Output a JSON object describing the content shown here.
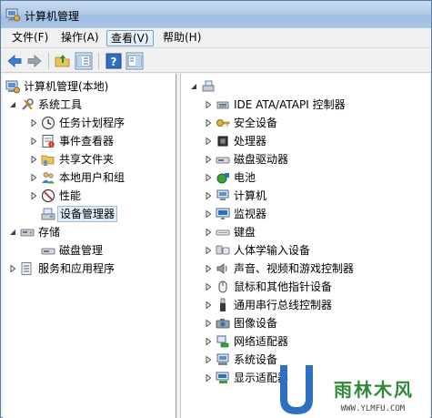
{
  "window": {
    "title": "计算机管理"
  },
  "menu": [
    {
      "label": "文件(F)"
    },
    {
      "label": "操作(A)"
    },
    {
      "label": "查看(V)"
    },
    {
      "label": "帮助(H)"
    }
  ],
  "tree": {
    "root": "计算机管理(本地)",
    "system_tools": "系统工具",
    "task_scheduler": "任务计划程序",
    "event_viewer": "事件查看器",
    "shared_folders": "共享文件夹",
    "local_users": "本地用户和组",
    "performance": "性能",
    "device_manager": "设备管理器",
    "storage": "存储",
    "disk_management": "磁盘管理",
    "services": "服务和应用程序"
  },
  "devices": [
    {
      "label": "IDE ATA/ATAPI 控制器",
      "icon": "ide-controller-icon"
    },
    {
      "label": "安全设备",
      "icon": "security-key-icon"
    },
    {
      "label": "处理器",
      "icon": "processor-icon"
    },
    {
      "label": "磁盘驱动器",
      "icon": "disk-drive-icon"
    },
    {
      "label": "电池",
      "icon": "battery-icon"
    },
    {
      "label": "计算机",
      "icon": "computer-icon"
    },
    {
      "label": "监视器",
      "icon": "monitor-icon"
    },
    {
      "label": "键盘",
      "icon": "keyboard-icon"
    },
    {
      "label": "人体学输入设备",
      "icon": "hid-icon"
    },
    {
      "label": "声音、视频和游戏控制器",
      "icon": "speaker-icon"
    },
    {
      "label": "鼠标和其他指针设备",
      "icon": "mouse-icon"
    },
    {
      "label": "通用串行总线控制器",
      "icon": "usb-icon"
    },
    {
      "label": "图像设备",
      "icon": "camera-icon"
    },
    {
      "label": "网络适配器",
      "icon": "network-adapter-icon"
    },
    {
      "label": "系统设备",
      "icon": "system-device-icon"
    },
    {
      "label": "显示适配器",
      "icon": "display-adapter-icon"
    }
  ],
  "watermark": {
    "brand": "雨林木风",
    "url": "WWW.YLMFU.COM"
  },
  "colors": {
    "selection": "#e2ecf7",
    "accent": "#3a6ea5"
  }
}
